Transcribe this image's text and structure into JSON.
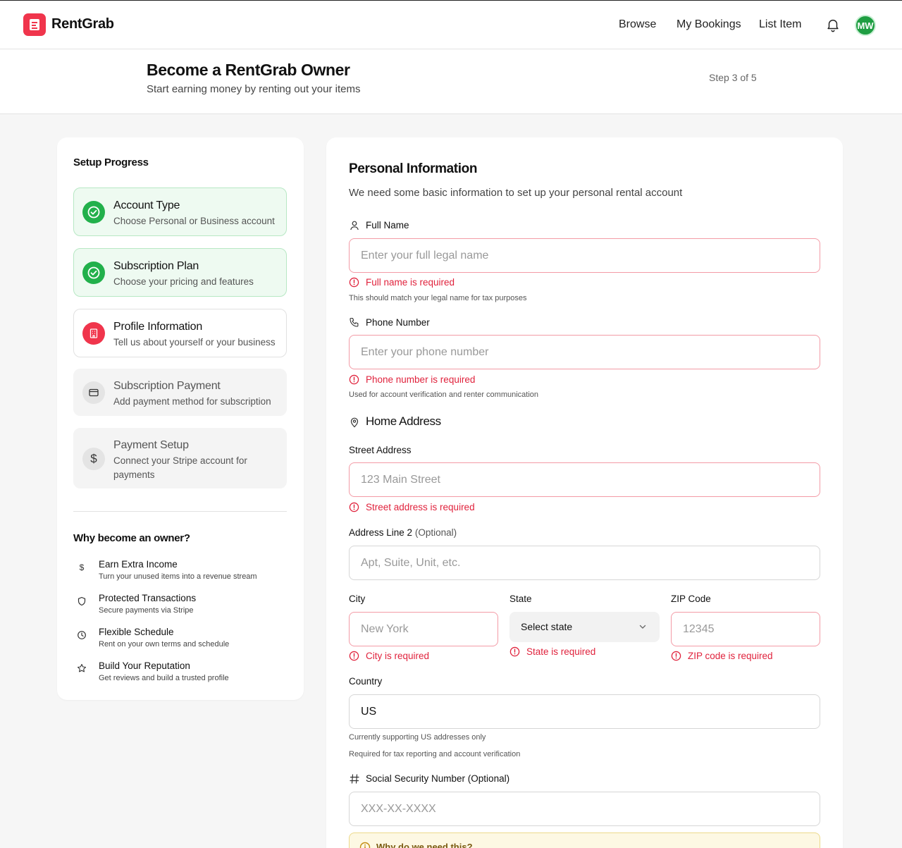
{
  "app": {
    "name": "RentGrab",
    "nav": [
      "Browse",
      "My Bookings",
      "List Item"
    ],
    "avatar_initials": "MW",
    "brand_color": "#f0354c"
  },
  "header": {
    "title": "Become a RentGrab Owner",
    "subtitle": "Start earning money by renting out your items",
    "step_indicator": "Step 3 of 5"
  },
  "sidebar": {
    "title": "Setup Progress",
    "steps": [
      {
        "label": "Account Type",
        "desc": "Choose Personal or Business account",
        "status": "completed",
        "icon": "check-icon"
      },
      {
        "label": "Subscription Plan",
        "desc": "Choose your pricing and features",
        "status": "completed",
        "icon": "check-icon"
      },
      {
        "label": "Profile Information",
        "desc": "Tell us about yourself or your business",
        "status": "current",
        "icon": "building-icon"
      },
      {
        "label": "Subscription Payment",
        "desc": "Add payment method for subscription",
        "status": "pending",
        "icon": "credit-card-icon"
      },
      {
        "label": "Payment Setup",
        "desc": "Connect your Stripe account for payments",
        "status": "pending",
        "icon": "dollar-icon"
      }
    ],
    "why_title": "Why become an owner?",
    "benefits": [
      {
        "title": "Earn Extra Income",
        "desc": "Turn your unused items into a revenue stream",
        "icon": "dollar-icon"
      },
      {
        "title": "Protected Transactions",
        "desc": "Secure payments via Stripe",
        "icon": "shield-icon"
      },
      {
        "title": "Flexible Schedule",
        "desc": "Rent on your own terms and schedule",
        "icon": "clock-icon"
      },
      {
        "title": "Build Your Reputation",
        "desc": "Get reviews and build a trusted profile",
        "icon": "star-icon"
      }
    ]
  },
  "form": {
    "title": "Personal Information",
    "subtitle": "We need some basic information to set up your personal rental account",
    "full_name": {
      "label": "Full Name",
      "placeholder": "Enter your full legal name",
      "value": "",
      "error": "Full name is required",
      "hint": "This should match your legal name for tax purposes"
    },
    "phone": {
      "label": "Phone Number",
      "placeholder": "Enter your phone number",
      "value": "",
      "error": "Phone number is required",
      "hint": "Used for account verification and renter communication"
    },
    "address_title": "Home Address",
    "street": {
      "label": "Street Address",
      "placeholder": "123 Main Street",
      "value": "",
      "error": "Street address is required"
    },
    "address2": {
      "label": "Address Line 2",
      "optional": "(Optional)",
      "placeholder": "Apt, Suite, Unit, etc.",
      "value": ""
    },
    "city": {
      "label": "City",
      "placeholder": "New York",
      "value": "",
      "error": "City is required"
    },
    "state": {
      "label": "State",
      "value": "Select state",
      "error": "State is required"
    },
    "zip": {
      "label": "ZIP Code",
      "placeholder": "12345",
      "value": "",
      "error": "ZIP code is required"
    },
    "country": {
      "label": "Country",
      "value": "US",
      "hint1": "Currently supporting US addresses only",
      "hint2": "Required for tax reporting and account verification"
    },
    "ssn": {
      "label": "Social Security Number (Optional)",
      "placeholder": "XXX-XX-XXXX",
      "value": ""
    },
    "notice": "Why do we need this?",
    "error_color": "#e0223c",
    "success_color": "#22b04b"
  }
}
